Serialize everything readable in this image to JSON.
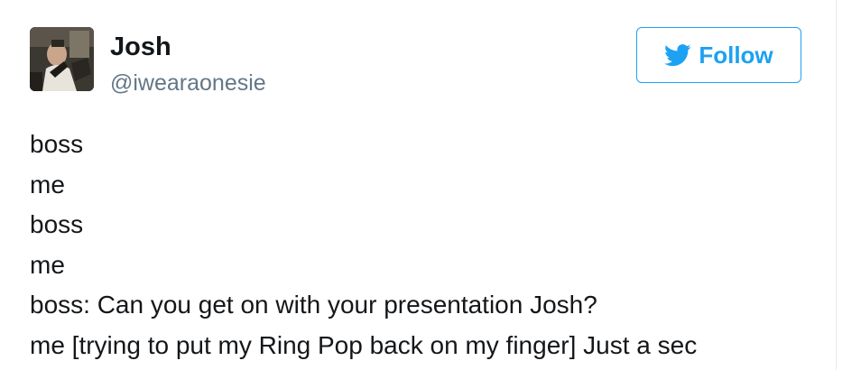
{
  "author": {
    "name": "Josh",
    "handle": "@iwearaonesie"
  },
  "follow_button": {
    "label": "Follow",
    "icon": "twitter-bird-icon",
    "color": "#1da1f2"
  },
  "tweet": {
    "lines": [
      "boss",
      "me",
      "boss",
      "me",
      "boss: Can you get on with your presentation Josh?",
      "me [trying to put my Ring Pop back on my finger] Just a sec"
    ]
  },
  "colors": {
    "text": "#14171a",
    "secondary": "#657786",
    "accent": "#1da1f2"
  }
}
